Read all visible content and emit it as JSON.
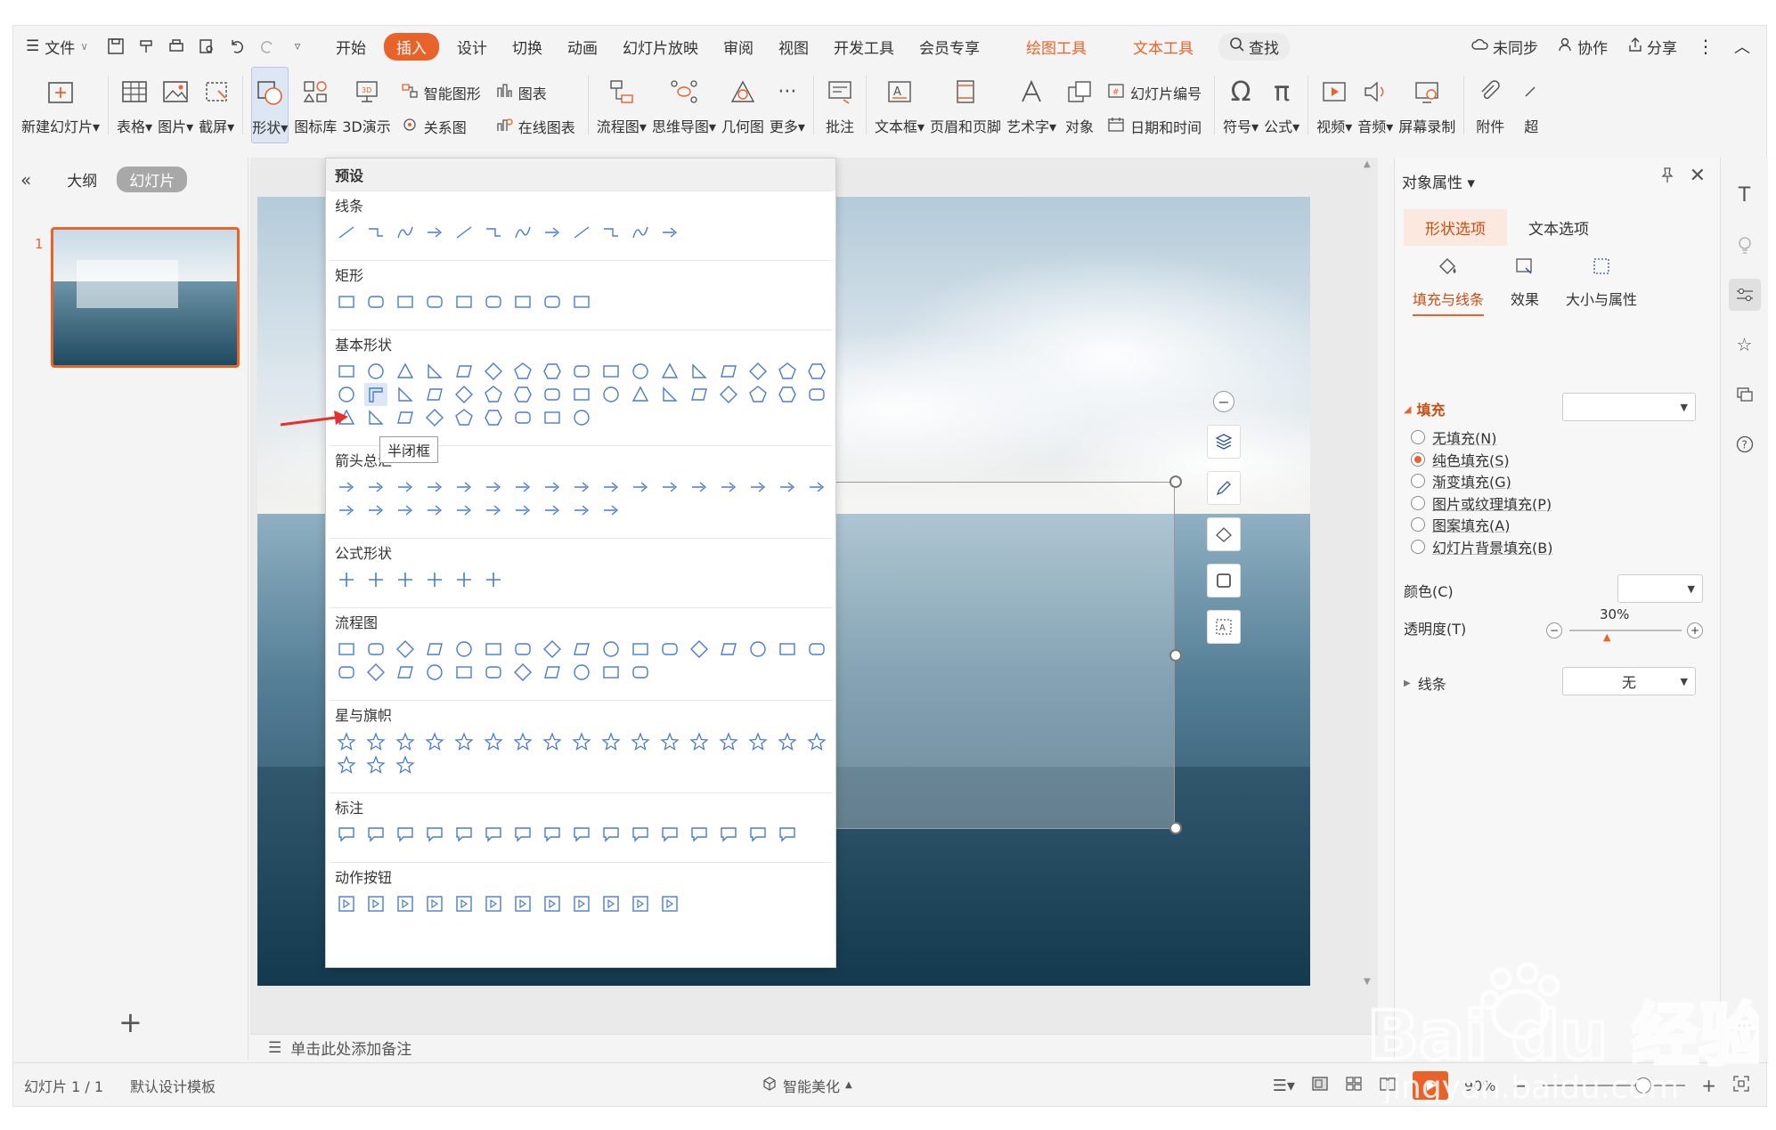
{
  "menubar": {
    "file_label": "文件",
    "tabs": [
      {
        "label": "开始",
        "active": false,
        "highlight": false
      },
      {
        "label": "插入",
        "active": true,
        "highlight": false
      },
      {
        "label": "设计",
        "active": false,
        "highlight": false
      },
      {
        "label": "切换",
        "active": false,
        "highlight": false
      },
      {
        "label": "动画",
        "active": false,
        "highlight": false
      },
      {
        "label": "幻灯片放映",
        "active": false,
        "highlight": false
      },
      {
        "label": "审阅",
        "active": false,
        "highlight": false
      },
      {
        "label": "视图",
        "active": false,
        "highlight": false
      },
      {
        "label": "开发工具",
        "active": false,
        "highlight": false
      },
      {
        "label": "会员专享",
        "active": false,
        "highlight": false
      },
      {
        "label": "绘图工具",
        "active": false,
        "highlight": true
      },
      {
        "label": "文本工具",
        "active": false,
        "highlight": true
      }
    ],
    "search_label": "查找",
    "unsynced": "未同步",
    "collaborate": "协作",
    "share": "分享"
  },
  "ribbon": {
    "new_slide": "新建幻灯片",
    "table": "表格",
    "picture": "图片",
    "screenshot": "截屏",
    "shape": "形状",
    "icon_lib": "图标库",
    "demo3d": "3D演示",
    "smart_art": "智能图形",
    "relation": "关系图",
    "chart": "图表",
    "online_chart": "在线图表",
    "flowchart": "流程图",
    "mindmap": "思维导图",
    "geometry": "几何图",
    "more": "更多",
    "comment": "批注",
    "textbox": "文本框",
    "header_footer": "页眉和页脚",
    "wordart": "艺术字",
    "object": "对象",
    "slide_number": "幻灯片编号",
    "date_time": "日期和时间",
    "symbol": "符号",
    "formula": "公式",
    "video": "视频",
    "audio": "音频",
    "screen_record": "屏幕录制",
    "attachment": "附件",
    "hyperlink_cut": "超"
  },
  "left_panel": {
    "outline_tab": "大纲",
    "slides_tab": "幻灯片",
    "slide_number": "1"
  },
  "shape_gallery": {
    "header": "预设",
    "sections": [
      {
        "title": "线条",
        "rows": [
          12
        ]
      },
      {
        "title": "矩形",
        "rows": [
          9
        ]
      },
      {
        "title": "基本形状",
        "rows": [
          17,
          17,
          9
        ]
      },
      {
        "title": "箭头总汇",
        "rows": [
          17,
          10
        ]
      },
      {
        "title": "公式形状",
        "rows": [
          6
        ]
      },
      {
        "title": "流程图",
        "rows": [
          17,
          11
        ]
      },
      {
        "title": "星与旗帜",
        "rows": [
          17,
          3
        ]
      },
      {
        "title": "标注",
        "rows": [
          16
        ]
      },
      {
        "title": "动作按钮",
        "rows": [
          12
        ]
      }
    ],
    "tooltip": "半闭框"
  },
  "notes": {
    "placeholder": "单击此处添加备注"
  },
  "statusbar": {
    "slide_info": "幻灯片 1 / 1",
    "template": "默认设计模板",
    "smart_beautify": "智能美化",
    "zoom": "90%"
  },
  "right_panel": {
    "title": "对象属性",
    "tabs": [
      "形状选项",
      "文本选项"
    ],
    "subtabs": [
      "填充与线条",
      "效果",
      "大小与属性"
    ],
    "fill_section": "填充",
    "fill_options": [
      {
        "label": "无填充(N)",
        "selected": false
      },
      {
        "label": "纯色填充(S)",
        "selected": true
      },
      {
        "label": "渐变填充(G)",
        "selected": false
      },
      {
        "label": "图片或纹理填充(P)",
        "selected": false
      },
      {
        "label": "图案填充(A)",
        "selected": false
      },
      {
        "label": "幻灯片背景填充(B)",
        "selected": false
      }
    ],
    "color_label": "颜色(C)",
    "transparency_label": "透明度(T)",
    "transparency_value": "30%",
    "line_section": "线条",
    "line_value": "无"
  },
  "colors": {
    "accent": "#e8632a",
    "icon_blue": "#2f5597",
    "shape_stroke": "#4a7cc9"
  },
  "watermark": {
    "text_top": "Bai du 经验",
    "text_bottom": "jingyan.baidu.com"
  }
}
